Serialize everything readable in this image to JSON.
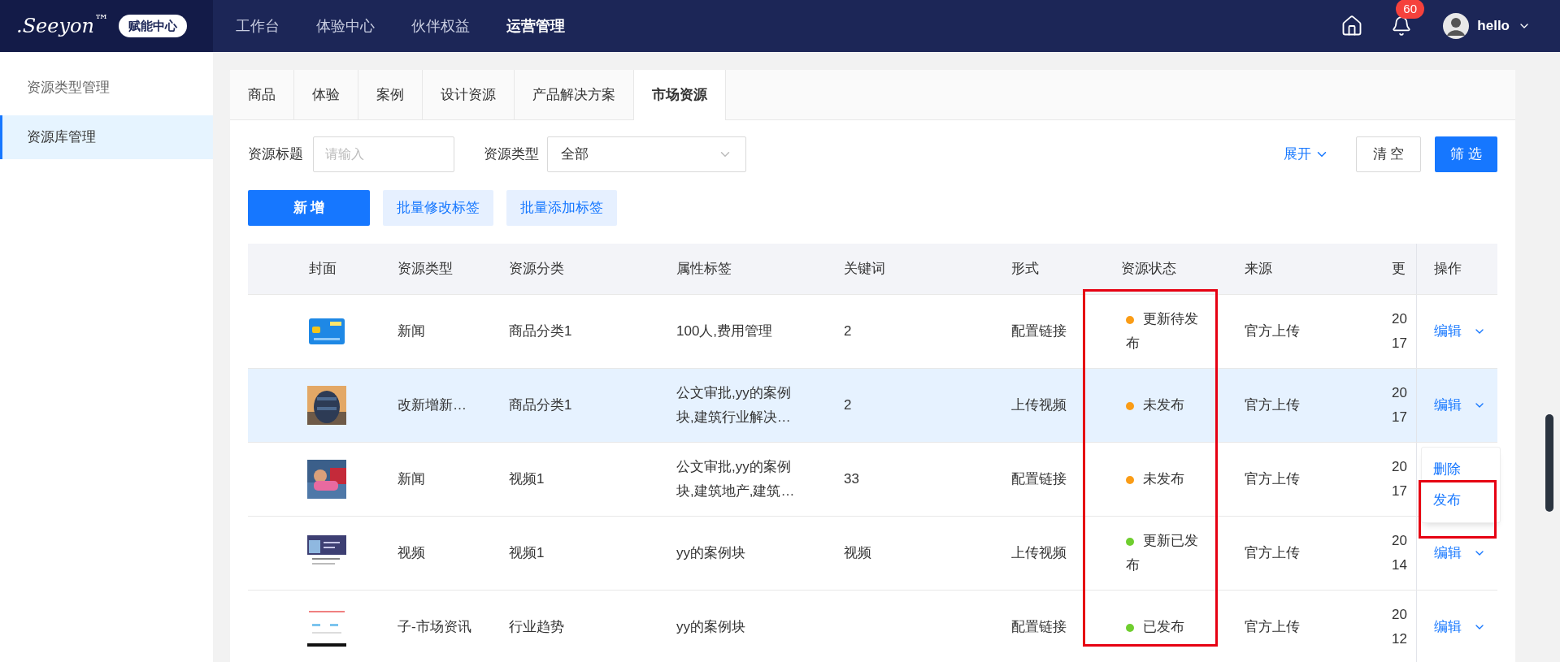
{
  "header": {
    "logo": ".Seeyon$^{™}$",
    "badge": "赋能中心",
    "nav": [
      {
        "label": "工作台",
        "selected": false
      },
      {
        "label": "体验中心",
        "selected": false
      },
      {
        "label": "伙伴权益",
        "selected": false
      },
      {
        "label": "运营管理",
        "selected": true
      }
    ],
    "notifications": "60",
    "user": "hello"
  },
  "sidebar": {
    "items": [
      {
        "label": "资源类型管理",
        "selected": false
      },
      {
        "label": "资源库管理",
        "selected": true
      }
    ]
  },
  "tabs": [
    {
      "label": "商品",
      "selected": false
    },
    {
      "label": "体验",
      "selected": false
    },
    {
      "label": "案例",
      "selected": false
    },
    {
      "label": "设计资源",
      "selected": false
    },
    {
      "label": "产品解决方案",
      "selected": false
    },
    {
      "label": "市场资源",
      "selected": true
    }
  ],
  "filters": {
    "title_label": "资源标题",
    "title_placeholder": "请输入",
    "type_label": "资源类型",
    "type_value": "全部",
    "expand": "展开",
    "clear": "清 空",
    "filter": "筛 选"
  },
  "actions": [
    "新 增",
    "批量修改标签",
    "批量添加标签"
  ],
  "table": {
    "columns": [
      "封面",
      "资源类型",
      "资源分类",
      "属性标签",
      "关键词",
      "形式",
      "资源状态",
      "来源",
      "更",
      "操作"
    ],
    "rows": [
      {
        "highlighted": false,
        "cover": {
          "kind": "picture"
        },
        "type": "新闻",
        "category": "商品分类1",
        "tags": "100人,费用管理",
        "keywords": "2",
        "form": "配置链接",
        "status": "更新待发布",
        "color": "#fa9c16",
        "source": "官方上传",
        "updated": [
          "20",
          "17"
        ],
        "action": "编辑"
      },
      {
        "highlighted": true,
        "cover": {
          "kind": "picture"
        },
        "type": "改新增新…",
        "category": "商品分类1",
        "tags": "公文审批,yy的案例块,建筑行业解决…",
        "keywords": "2",
        "form": "上传视频",
        "status": "未发布",
        "color": "#fa9c16",
        "source": "官方上传",
        "updated": [
          "20",
          "17"
        ],
        "action": "编辑"
      },
      {
        "highlighted": false,
        "cover": {
          "kind": "picture"
        },
        "type": "新闻",
        "category": "视频1",
        "tags": "公文审批,yy的案例块,建筑地产,建筑…",
        "keywords": "33",
        "form": "配置链接",
        "status": "未发布",
        "color": "#fa9c16",
        "source": "官方上传",
        "updated": [
          "20",
          "17"
        ]
      },
      {
        "highlighted": false,
        "cover": {
          "kind": "picture"
        },
        "type": "视频",
        "category": "视频1",
        "tags": "yy的案例块",
        "keywords": "视频",
        "form": "上传视频",
        "status": "更新已发布",
        "color": "#6fce2f",
        "source": "官方上传",
        "updated": [
          "20",
          "14"
        ],
        "action": "编辑"
      },
      {
        "highlighted": false,
        "cover": {
          "kind": "picture"
        },
        "type": "子-市场资讯",
        "category": "行业趋势",
        "tags": "yy的案例块",
        "form": "配置链接",
        "status": "已发布",
        "color": "#6fce2f",
        "source": "官方上传",
        "updated": [
          "20",
          "12"
        ],
        "action": "编辑"
      }
    ]
  },
  "menu": [
    "删除",
    "发布"
  ]
}
